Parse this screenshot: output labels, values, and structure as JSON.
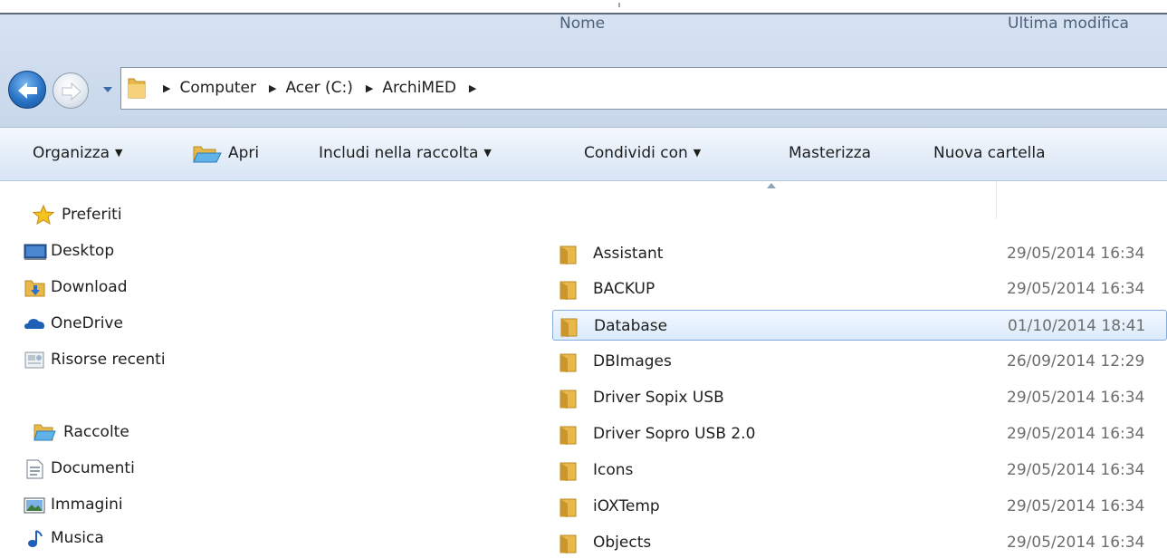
{
  "address_bar": {
    "breadcrumbs": [
      "Computer",
      "Acer (C:)",
      "ArchiMED"
    ]
  },
  "toolbar": {
    "organize": "Organizza",
    "open": "Apri",
    "include_in_library": "Includi nella raccolta",
    "share_with": "Condividi con",
    "burn": "Masterizza",
    "new_folder": "Nuova cartella"
  },
  "sidebar": {
    "favorites": {
      "label": "Preferiti",
      "items": [
        {
          "label": "Desktop",
          "icon": "desktop-icon"
        },
        {
          "label": "Download",
          "icon": "download-folder-icon"
        },
        {
          "label": "OneDrive",
          "icon": "onedrive-icon"
        },
        {
          "label": "Risorse recenti",
          "icon": "recent-places-icon"
        }
      ]
    },
    "libraries": {
      "label": "Raccolte",
      "items": [
        {
          "label": "Documenti",
          "icon": "documents-icon"
        },
        {
          "label": "Immagini",
          "icon": "pictures-icon"
        },
        {
          "label": "Musica",
          "icon": "music-icon"
        }
      ]
    }
  },
  "filelist": {
    "columns": {
      "name": "Nome",
      "modified": "Ultima modifica"
    },
    "selected_index": 2,
    "rows": [
      {
        "name": "Assistant",
        "modified": "29/05/2014 16:34"
      },
      {
        "name": "BACKUP",
        "modified": "29/05/2014 16:34"
      },
      {
        "name": "Database",
        "modified": "01/10/2014 18:41"
      },
      {
        "name": "DBImages",
        "modified": "26/09/2014 12:29"
      },
      {
        "name": "Driver Sopix USB",
        "modified": "29/05/2014 16:34"
      },
      {
        "name": "Driver Sopro USB 2.0",
        "modified": "29/05/2014 16:34"
      },
      {
        "name": "Icons",
        "modified": "29/05/2014 16:34"
      },
      {
        "name": "iOXTemp",
        "modified": "29/05/2014 16:34"
      },
      {
        "name": "Objects",
        "modified": "29/05/2014 16:34"
      }
    ]
  },
  "colors": {
    "selection_border": "#84acdd",
    "folder": "#e8b84a",
    "header_text": "#4c607a"
  }
}
